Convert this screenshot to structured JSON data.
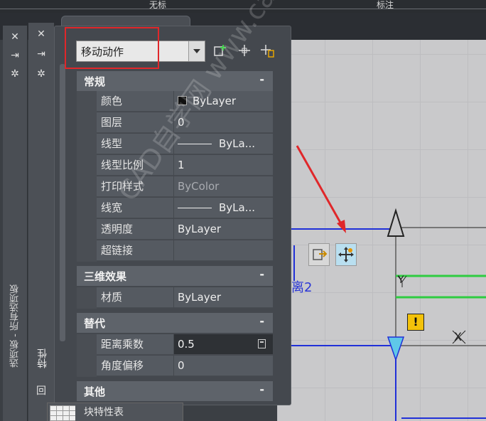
{
  "top_tabs": [
    "无标",
    "标注"
  ],
  "palette_left": {
    "vertical_title": "选项板 - 所有选项板",
    "icons": [
      "close-icon",
      "pin-icon",
      "settings-icon"
    ]
  },
  "palette_props": {
    "vertical_title": "特性",
    "icons": [
      "close-icon",
      "pin-icon",
      "settings-icon"
    ],
    "bottom_icon": "回"
  },
  "toolbar": {
    "selector_value": "移动动作",
    "icons": [
      "quick-select-icon",
      "select-objects-icon",
      "toggle-pickadd-icon"
    ]
  },
  "sections": {
    "general": {
      "label": "常规",
      "toggle": "-",
      "rows": [
        {
          "label": "颜色",
          "value": "ByLayer",
          "swatch_color": "#111111"
        },
        {
          "label": "图层",
          "value": "0"
        },
        {
          "label": "线型",
          "value": "ByLa..."
        },
        {
          "label": "线型比例",
          "value": "1"
        },
        {
          "label": "打印样式",
          "value": "ByColor"
        },
        {
          "label": "线宽",
          "value": "ByLa..."
        },
        {
          "label": "透明度",
          "value": "ByLayer"
        },
        {
          "label": "超链接",
          "value": ""
        }
      ]
    },
    "three_d": {
      "label": "三维效果",
      "toggle": "-",
      "rows": [
        {
          "label": "材质",
          "value": "ByLayer"
        }
      ]
    },
    "override": {
      "label": "替代",
      "toggle": "-",
      "rows": [
        {
          "label": "距离乘数",
          "value": "0.5"
        },
        {
          "label": "角度偏移",
          "value": "0"
        }
      ]
    },
    "other": {
      "label": "其他",
      "toggle": "-"
    }
  },
  "bottom_tab": {
    "label": "块特性表"
  },
  "canvas": {
    "dimension_text": "离2",
    "axis_label": "Y",
    "cross_label": "X",
    "warning": "!"
  },
  "watermark": "CAD自学网 www.cadzxw.com",
  "colors": {
    "highlight": "#e0272a",
    "arrow": "#e0272a",
    "blue_geometry": "#2030d8",
    "green_geometry": "#2ecc40",
    "warning": "#f3c20a"
  }
}
